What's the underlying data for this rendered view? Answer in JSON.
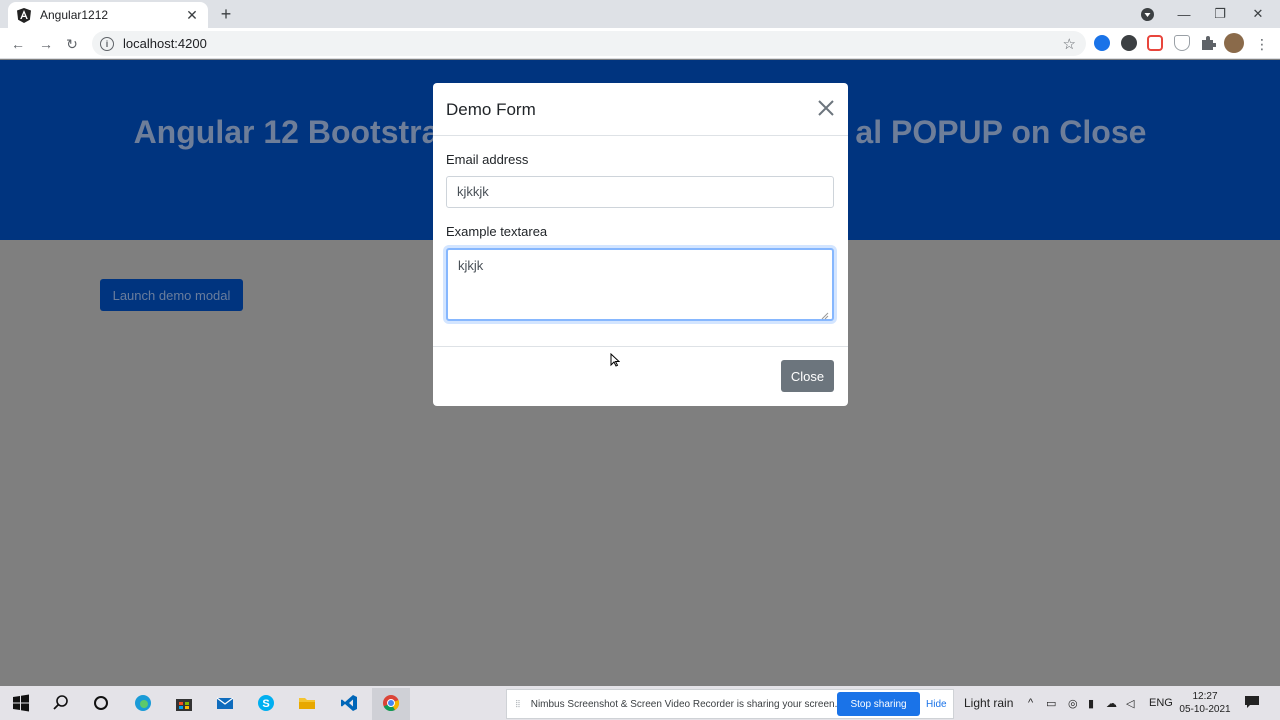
{
  "browser": {
    "tab_title": "Angular1212",
    "url": "localhost:4200"
  },
  "page": {
    "heading_left": "Angular 12 Bootstra",
    "heading_right": "al POPUP on Close",
    "launch_button": "Launch demo modal"
  },
  "modal": {
    "title": "Demo Form",
    "email_label": "Email address",
    "email_value": "kjkkjk",
    "textarea_label": "Example textarea",
    "textarea_value": "kjkjk",
    "close_button": "Close"
  },
  "taskbar": {
    "share_message": "Nimbus Screenshot & Screen Video Recorder is sharing your screen.",
    "stop_sharing": "Stop sharing",
    "hide": "Hide",
    "weather": "Light rain",
    "language": "ENG",
    "time": "12:27",
    "date": "05-10-2021"
  },
  "colors": {
    "jumbotron": "#00347f",
    "backdrop": "#7f7f7f",
    "secondary_button": "#6c757d",
    "focus_border": "#86b7fe",
    "share_button": "#1a73e8"
  }
}
